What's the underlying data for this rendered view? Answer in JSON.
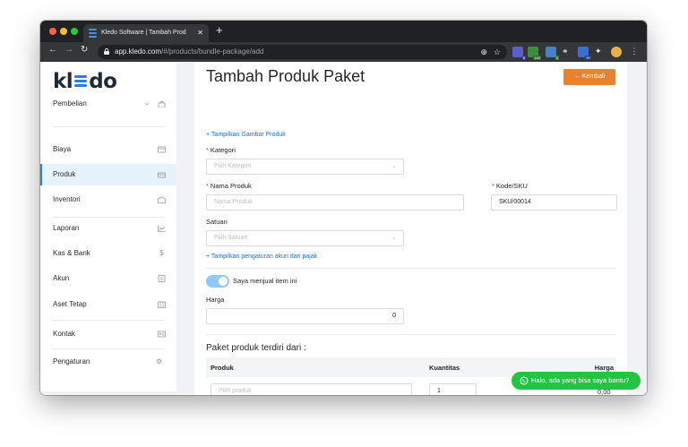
{
  "browser": {
    "tab_title": "Kledo Software | Tambah Prod",
    "new_tab": "+",
    "url_host": "app.kledo.com",
    "url_path": "/#/products/bundle-package/add",
    "extension_badges": [
      "8",
      "160",
      "1",
      "9+"
    ]
  },
  "sidebar": {
    "logo": {
      "left": "kl",
      "right": "do"
    },
    "items": [
      {
        "label": "Pembelian",
        "icon": "shopping-bag-icon"
      },
      {
        "label": "Biaya",
        "icon": "credit-card-icon"
      },
      {
        "label": "Produk",
        "icon": "box-icon",
        "active": true
      },
      {
        "label": "Inventori",
        "icon": "warehouse-icon"
      },
      {
        "label": "Laporan",
        "icon": "line-chart-icon"
      },
      {
        "label": "Kas & Bank",
        "icon": "dollar-icon"
      },
      {
        "label": "Akun",
        "icon": "ledger-icon"
      },
      {
        "label": "Aset Tetap",
        "icon": "building-icon"
      },
      {
        "label": "Kontak",
        "icon": "contact-card-icon"
      },
      {
        "label": "Pengaturan",
        "icon": "gears-icon"
      }
    ],
    "collapse_label": "<"
  },
  "page": {
    "title": "Tambah Produk Paket",
    "back_button": "Kembali",
    "show_image_link": "Tampilkan Gambar Produk",
    "category": {
      "label": "Kategori",
      "placeholder": "Pilih Kategori"
    },
    "product_name": {
      "label": "Nama Produk",
      "placeholder": "Nama Produk"
    },
    "sku": {
      "label": "Kode/SKU",
      "value": "SKU/00014"
    },
    "unit": {
      "label": "Satuan",
      "placeholder": "Pilih Satuan"
    },
    "show_account_link": "Tampilkan pengaturan akun dan pajak",
    "sell_toggle": {
      "label": "Saya menjual item ini",
      "on": true
    },
    "price": {
      "label": "Harga",
      "value": "0"
    },
    "bundle_section": "Paket produk terdiri dari :",
    "table": {
      "headers": [
        "Produk",
        "Kuantitas",
        "Harga"
      ],
      "row": {
        "product_placeholder": "Pilih produk",
        "quantity": "1",
        "price": "0,00"
      }
    }
  },
  "whatsapp": {
    "label": "Halo, ada yang bisa saya bantu?"
  },
  "colors": {
    "accent": "#2a7fe4",
    "back_button": "#e8822e",
    "whatsapp": "#25c342",
    "required": "#e03c3c"
  }
}
